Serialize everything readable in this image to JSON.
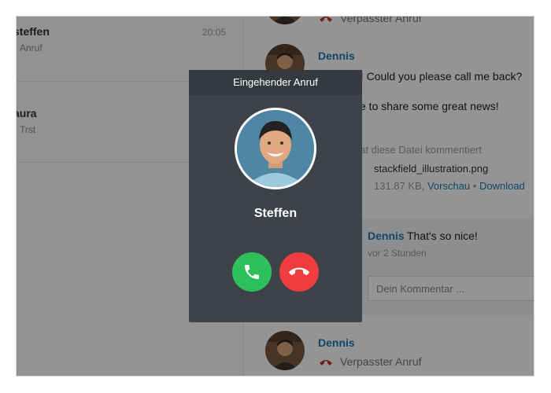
{
  "chat_list": [
    {
      "name": "steffen",
      "time": "20:05",
      "preview": "Anruf"
    },
    {
      "name": "aura",
      "time": "",
      "preview": "Trst"
    }
  ],
  "conversation": {
    "top_missed_call": "Verpasster Anruf",
    "message1": {
      "sender": "Dennis",
      "line1": "n! Could you please call me back?",
      "line2": "ke to share some great news!"
    },
    "file_activity": {
      "action": "hat diese Datei kommentiert",
      "file_name": "stackfield_illustration.png",
      "size": "131.87 KB,",
      "preview_link": "Vorschau",
      "dot": "•",
      "download_link": "Download"
    },
    "comment": {
      "sender": "Dennis",
      "text": "That's so nice!",
      "time": "vor 2 Stunden",
      "input_placeholder": "Dein Kommentar ..."
    },
    "message2": {
      "sender": "Dennis",
      "missed_call": "Verpasster Anruf"
    }
  },
  "call_modal": {
    "title": "Eingehender Anruf",
    "caller_name": "Steffen",
    "accept_icon": "phone-icon",
    "decline_icon": "phone-hangup-icon"
  },
  "colors": {
    "accent_link": "#1f7bb6",
    "accept": "#2ec05d",
    "decline": "#f03c3e",
    "missed_call": "#c0393b",
    "modal_bg": "#3e4249"
  }
}
